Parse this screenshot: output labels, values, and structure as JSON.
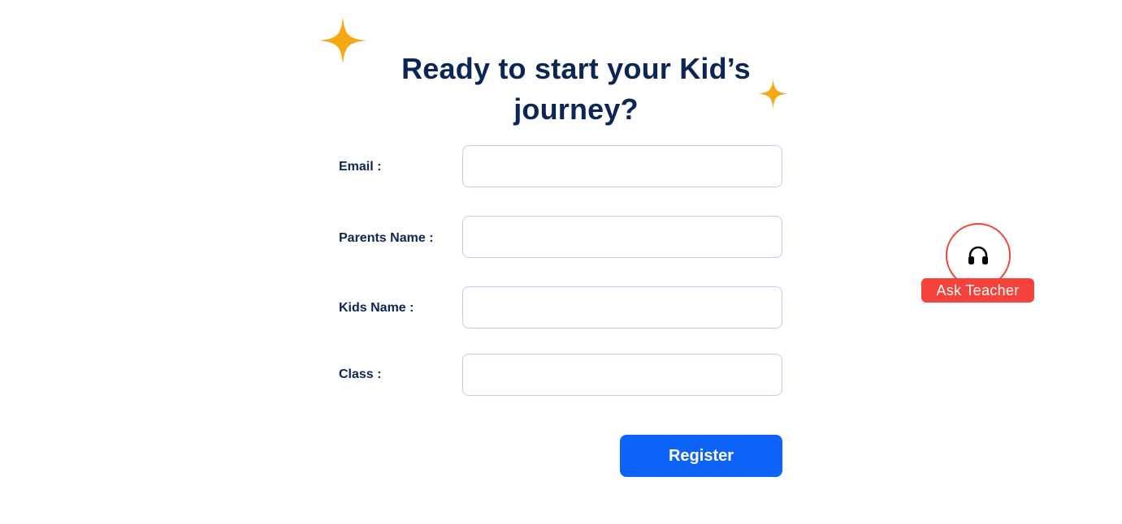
{
  "heading": "Ready to start your Kid’s journey?",
  "form": {
    "email_label": "Email :",
    "email_value": "",
    "parent_label": "Parents Name :",
    "parent_value": "",
    "kid_label": "Kids Name :",
    "kid_value": "",
    "class_label": "Class :",
    "class_value": "",
    "register_label": "Register"
  },
  "ask_widget": {
    "icon": "headphones-icon",
    "label": "Ask Teacher"
  },
  "colors": {
    "heading_text": "#0b2556",
    "sparkle": "#f6a714",
    "input_border": "#b8d0ee",
    "primary_button": "#0d62f7",
    "ask_accent": "#f4433a"
  }
}
